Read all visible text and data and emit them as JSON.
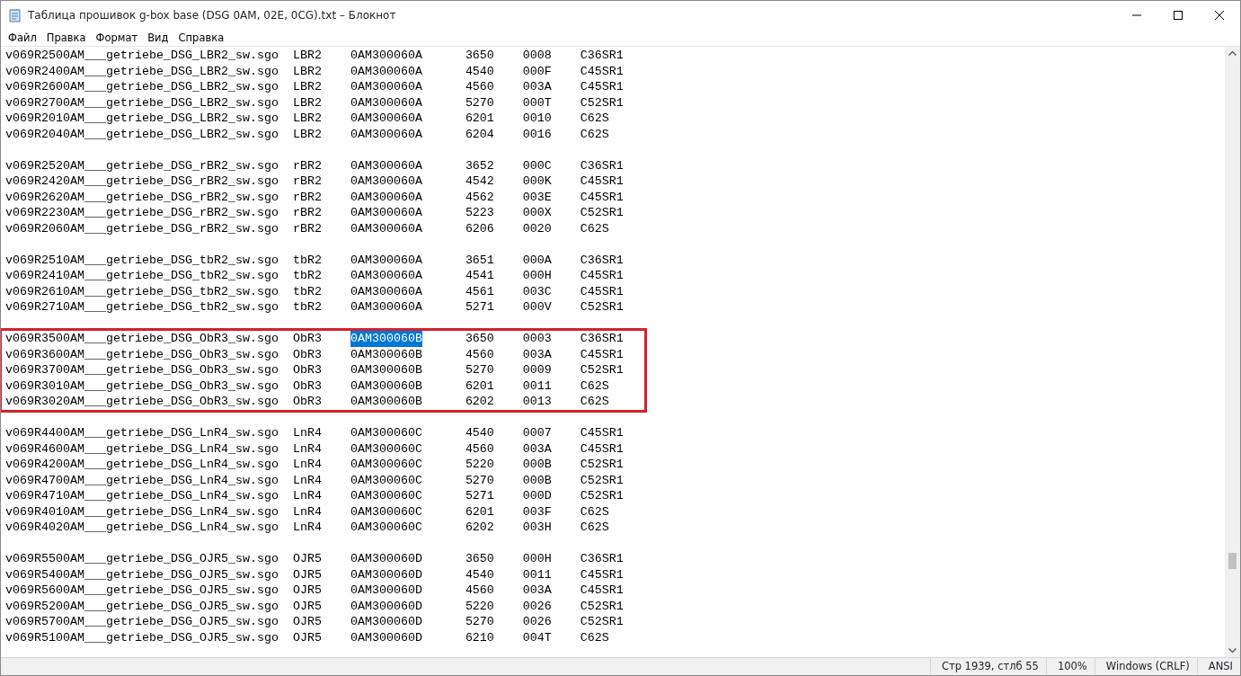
{
  "window": {
    "title": "Таблица прошивок g-box base (DSG 0AM, 02E, 0CG).txt – Блокнот"
  },
  "menu": [
    "Файл",
    "Правка",
    "Формат",
    "Вид",
    "Справка"
  ],
  "groups": [
    {
      "framed": false,
      "rows": [
        {
          "file": "v069R2500AM___getriebe_DSG_LBR2_sw.sgo",
          "variant": "LBR2",
          "part": "0AM300060A",
          "part_selected": false,
          "sw": "3650",
          "code": "0008",
          "box": "C36SR1"
        },
        {
          "file": "v069R2400AM___getriebe_DSG_LBR2_sw.sgo",
          "variant": "LBR2",
          "part": "0AM300060A",
          "part_selected": false,
          "sw": "4540",
          "code": "000F",
          "box": "C45SR1"
        },
        {
          "file": "v069R2600AM___getriebe_DSG_LBR2_sw.sgo",
          "variant": "LBR2",
          "part": "0AM300060A",
          "part_selected": false,
          "sw": "4560",
          "code": "003A",
          "box": "C45SR1"
        },
        {
          "file": "v069R2700AM___getriebe_DSG_LBR2_sw.sgo",
          "variant": "LBR2",
          "part": "0AM300060A",
          "part_selected": false,
          "sw": "5270",
          "code": "000T",
          "box": "C52SR1"
        },
        {
          "file": "v069R2010AM___getriebe_DSG_LBR2_sw.sgo",
          "variant": "LBR2",
          "part": "0AM300060A",
          "part_selected": false,
          "sw": "6201",
          "code": "0010",
          "box": "C62S"
        },
        {
          "file": "v069R2040AM___getriebe_DSG_LBR2_sw.sgo",
          "variant": "LBR2",
          "part": "0AM300060A",
          "part_selected": false,
          "sw": "6204",
          "code": "0016",
          "box": "C62S"
        }
      ]
    },
    {
      "framed": false,
      "rows": [
        {
          "file": "v069R2520AM___getriebe_DSG_rBR2_sw.sgo",
          "variant": "rBR2",
          "part": "0AM300060A",
          "part_selected": false,
          "sw": "3652",
          "code": "000C",
          "box": "C36SR1"
        },
        {
          "file": "v069R2420AM___getriebe_DSG_rBR2_sw.sgo",
          "variant": "rBR2",
          "part": "0AM300060A",
          "part_selected": false,
          "sw": "4542",
          "code": "000K",
          "box": "C45SR1"
        },
        {
          "file": "v069R2620AM___getriebe_DSG_rBR2_sw.sgo",
          "variant": "rBR2",
          "part": "0AM300060A",
          "part_selected": false,
          "sw": "4562",
          "code": "003E",
          "box": "C45SR1"
        },
        {
          "file": "v069R2230AM___getriebe_DSG_rBR2_sw.sgo",
          "variant": "rBR2",
          "part": "0AM300060A",
          "part_selected": false,
          "sw": "5223",
          "code": "000X",
          "box": "C52SR1"
        },
        {
          "file": "v069R2060AM___getriebe_DSG_rBR2_sw.sgo",
          "variant": "rBR2",
          "part": "0AM300060A",
          "part_selected": false,
          "sw": "6206",
          "code": "0020",
          "box": "C62S"
        }
      ]
    },
    {
      "framed": false,
      "rows": [
        {
          "file": "v069R2510AM___getriebe_DSG_tbR2_sw.sgo",
          "variant": "tbR2",
          "part": "0AM300060A",
          "part_selected": false,
          "sw": "3651",
          "code": "000A",
          "box": "C36SR1"
        },
        {
          "file": "v069R2410AM___getriebe_DSG_tbR2_sw.sgo",
          "variant": "tbR2",
          "part": "0AM300060A",
          "part_selected": false,
          "sw": "4541",
          "code": "000H",
          "box": "C45SR1"
        },
        {
          "file": "v069R2610AM___getriebe_DSG_tbR2_sw.sgo",
          "variant": "tbR2",
          "part": "0AM300060A",
          "part_selected": false,
          "sw": "4561",
          "code": "003C",
          "box": "C45SR1"
        },
        {
          "file": "v069R2710AM___getriebe_DSG_tbR2_sw.sgo",
          "variant": "tbR2",
          "part": "0AM300060A",
          "part_selected": false,
          "sw": "5271",
          "code": "000V",
          "box": "C52SR1"
        }
      ]
    },
    {
      "framed": true,
      "rows": [
        {
          "file": "v069R3500AM___getriebe_DSG_ObR3_sw.sgo",
          "variant": "ObR3",
          "part": "0AM300060B",
          "part_selected": true,
          "sw": "3650",
          "code": "0003",
          "box": "C36SR1"
        },
        {
          "file": "v069R3600AM___getriebe_DSG_ObR3_sw.sgo",
          "variant": "ObR3",
          "part": "0AM300060B",
          "part_selected": false,
          "sw": "4560",
          "code": "003A",
          "box": "C45SR1"
        },
        {
          "file": "v069R3700AM___getriebe_DSG_ObR3_sw.sgo",
          "variant": "ObR3",
          "part": "0AM300060B",
          "part_selected": false,
          "sw": "5270",
          "code": "0009",
          "box": "C52SR1"
        },
        {
          "file": "v069R3010AM___getriebe_DSG_ObR3_sw.sgo",
          "variant": "ObR3",
          "part": "0AM300060B",
          "part_selected": false,
          "sw": "6201",
          "code": "0011",
          "box": "C62S"
        },
        {
          "file": "v069R3020AM___getriebe_DSG_ObR3_sw.sgo",
          "variant": "ObR3",
          "part": "0AM300060B",
          "part_selected": false,
          "sw": "6202",
          "code": "0013",
          "box": "C62S"
        }
      ]
    },
    {
      "framed": false,
      "rows": [
        {
          "file": "v069R4400AM___getriebe_DSG_LnR4_sw.sgo",
          "variant": "LnR4",
          "part": "0AM300060C",
          "part_selected": false,
          "sw": "4540",
          "code": "0007",
          "box": "C45SR1"
        },
        {
          "file": "v069R4600AM___getriebe_DSG_LnR4_sw.sgo",
          "variant": "LnR4",
          "part": "0AM300060C",
          "part_selected": false,
          "sw": "4560",
          "code": "003A",
          "box": "C45SR1"
        },
        {
          "file": "v069R4200AM___getriebe_DSG_LnR4_sw.sgo",
          "variant": "LnR4",
          "part": "0AM300060C",
          "part_selected": false,
          "sw": "5220",
          "code": "000B",
          "box": "C52SR1"
        },
        {
          "file": "v069R4700AM___getriebe_DSG_LnR4_sw.sgo",
          "variant": "LnR4",
          "part": "0AM300060C",
          "part_selected": false,
          "sw": "5270",
          "code": "000B",
          "box": "C52SR1"
        },
        {
          "file": "v069R4710AM___getriebe_DSG_LnR4_sw.sgo",
          "variant": "LnR4",
          "part": "0AM300060C",
          "part_selected": false,
          "sw": "5271",
          "code": "000D",
          "box": "C52SR1"
        },
        {
          "file": "v069R4010AM___getriebe_DSG_LnR4_sw.sgo",
          "variant": "LnR4",
          "part": "0AM300060C",
          "part_selected": false,
          "sw": "6201",
          "code": "003F",
          "box": "C62S"
        },
        {
          "file": "v069R4020AM___getriebe_DSG_LnR4_sw.sgo",
          "variant": "LnR4",
          "part": "0AM300060C",
          "part_selected": false,
          "sw": "6202",
          "code": "003H",
          "box": "C62S"
        }
      ]
    },
    {
      "framed": false,
      "rows": [
        {
          "file": "v069R5500AM___getriebe_DSG_OJR5_sw.sgo",
          "variant": "OJR5",
          "part": "0AM300060D",
          "part_selected": false,
          "sw": "3650",
          "code": "000H",
          "box": "C36SR1"
        },
        {
          "file": "v069R5400AM___getriebe_DSG_OJR5_sw.sgo",
          "variant": "OJR5",
          "part": "0AM300060D",
          "part_selected": false,
          "sw": "4540",
          "code": "0011",
          "box": "C45SR1"
        },
        {
          "file": "v069R5600AM___getriebe_DSG_OJR5_sw.sgo",
          "variant": "OJR5",
          "part": "0AM300060D",
          "part_selected": false,
          "sw": "4560",
          "code": "003A",
          "box": "C45SR1"
        },
        {
          "file": "v069R5200AM___getriebe_DSG_OJR5_sw.sgo",
          "variant": "OJR5",
          "part": "0AM300060D",
          "part_selected": false,
          "sw": "5220",
          "code": "0026",
          "box": "C52SR1"
        },
        {
          "file": "v069R5700AM___getriebe_DSG_OJR5_sw.sgo",
          "variant": "OJR5",
          "part": "0AM300060D",
          "part_selected": false,
          "sw": "5270",
          "code": "0026",
          "box": "C52SR1"
        },
        {
          "file": "v069R5100AM___getriebe_DSG_OJR5_sw.sgo",
          "variant": "OJR5",
          "part": "0AM300060D",
          "part_selected": false,
          "sw": "6210",
          "code": "004T",
          "box": "C62S"
        }
      ]
    }
  ],
  "status_bar": {
    "position": "Стр 1939, стлб 55",
    "zoom": "100%",
    "line_endings": "Windows (CRLF)",
    "encoding": "ANSI"
  }
}
